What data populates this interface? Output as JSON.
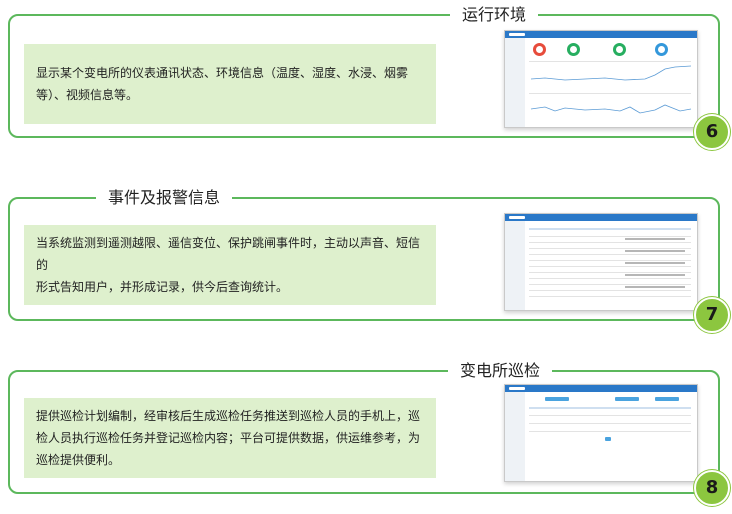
{
  "sections": [
    {
      "title": "运行环境",
      "description_lines": [
        "显示某个变电所的仪表通讯状态、环境信息（温度、湿度、水浸、烟雾",
        "等）、视频信息等。"
      ],
      "number": "6"
    },
    {
      "title": "事件及报警信息",
      "description_lines": [
        "当系统监测到遥测越限、遥信变位、保护跳闸事件时，主动以声音、短信的",
        "形式告知用户，并形成记录，供今后查询统计。"
      ],
      "number": "7"
    },
    {
      "title": "变电所巡检",
      "description_lines": [
        "提供巡检计划编制，经审核后生成巡检任务推送到巡检人员的手机上，巡",
        "检人员执行巡检任务并登记巡检内容；平台可提供数据，供运维参考，为",
        "巡检提供便利。"
      ],
      "number": "8"
    }
  ],
  "colors": {
    "border": "#5cb85c",
    "desc_bg": "#def0cd",
    "badge": "#8cc63f",
    "app_header": "#2a78c8"
  }
}
